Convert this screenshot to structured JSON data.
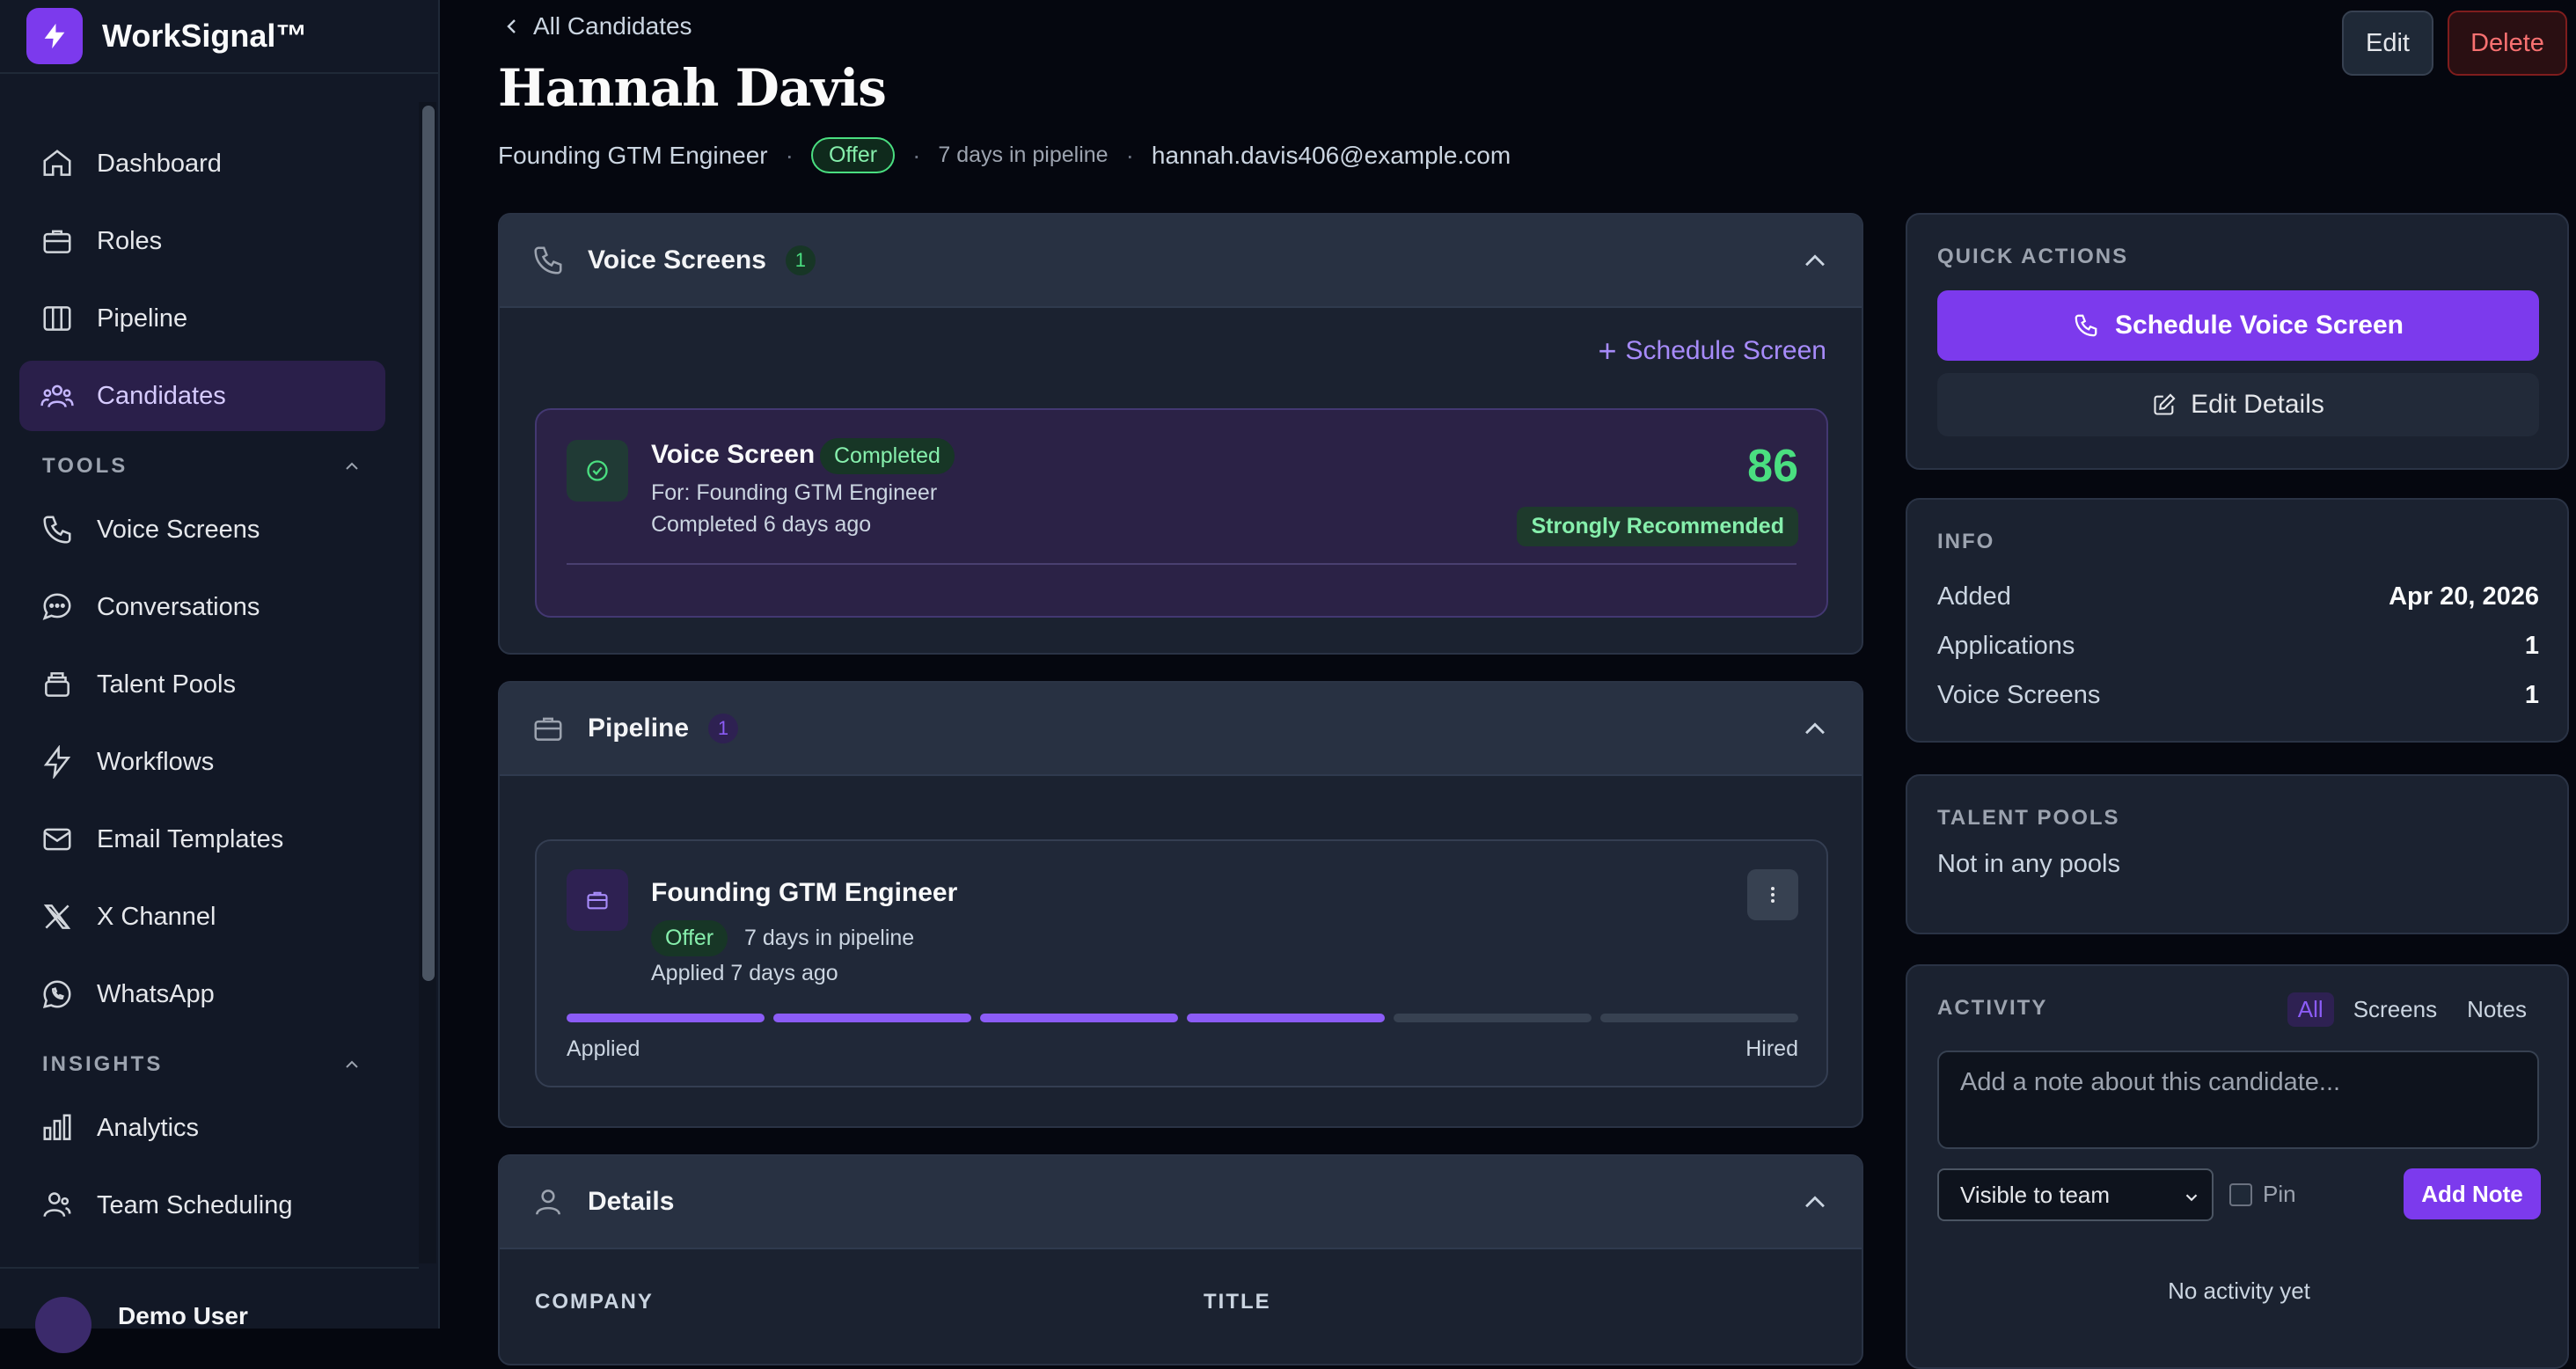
{
  "brand": {
    "name": "WorkSignal™"
  },
  "sidebar": {
    "main_items": [
      {
        "label": "Dashboard"
      },
      {
        "label": "Roles"
      },
      {
        "label": "Pipeline"
      },
      {
        "label": "Candidates"
      }
    ],
    "tools_label": "TOOLS",
    "tool_items": [
      {
        "label": "Voice Screens"
      },
      {
        "label": "Conversations"
      },
      {
        "label": "Talent Pools"
      },
      {
        "label": "Workflows"
      },
      {
        "label": "Email Templates"
      },
      {
        "label": "X Channel"
      },
      {
        "label": "WhatsApp"
      }
    ],
    "insights_label": "INSIGHTS",
    "insight_items": [
      {
        "label": "Analytics"
      },
      {
        "label": "Team Scheduling"
      }
    ],
    "user_name": "Demo User"
  },
  "header": {
    "back_label": "All Candidates",
    "title": "Hannah Davis",
    "role": "Founding GTM Engineer",
    "stage": "Offer",
    "days": "7 days in pipeline",
    "email": "hannah.davis406@example.com",
    "edit_label": "Edit",
    "delete_label": "Delete"
  },
  "voice": {
    "title": "Voice Screens",
    "count": "1",
    "schedule_label": "Schedule Screen",
    "item": {
      "title": "Voice Screen",
      "status": "Completed",
      "for": "For: Founding GTM Engineer",
      "when": "Completed 6 days ago",
      "score": "86",
      "recommendation": "Strongly Recommended"
    }
  },
  "pipeline": {
    "title": "Pipeline",
    "count": "1",
    "item": {
      "title": "Founding GTM Engineer",
      "stage": "Offer",
      "days": "7 days in pipeline",
      "applied": "Applied 7 days ago",
      "progress_done": 4,
      "progress_total": 6,
      "start_label": "Applied",
      "end_label": "Hired"
    }
  },
  "details": {
    "title": "Details",
    "company_label": "COMPANY",
    "title_label": "TITLE"
  },
  "quick_actions": {
    "label": "QUICK ACTIONS",
    "primary": "Schedule Voice Screen",
    "secondary": "Edit Details"
  },
  "info": {
    "label": "INFO",
    "rows": [
      {
        "k": "Added",
        "v": "Apr 20, 2026"
      },
      {
        "k": "Applications",
        "v": "1"
      },
      {
        "k": "Voice Screens",
        "v": "1"
      }
    ]
  },
  "talent_pools": {
    "label": "TALENT POOLS",
    "empty": "Not in any pools"
  },
  "activity": {
    "label": "ACTIVITY",
    "tabs": [
      "All",
      "Screens",
      "Notes"
    ],
    "placeholder": "Add a note about this candidate...",
    "visibility": "Visible to team",
    "pin_label": "Pin",
    "add_label": "Add Note",
    "empty": "No activity yet"
  },
  "colors": {
    "accent": "#7c3aed",
    "success": "#4ade80",
    "danger": "#f87171"
  }
}
